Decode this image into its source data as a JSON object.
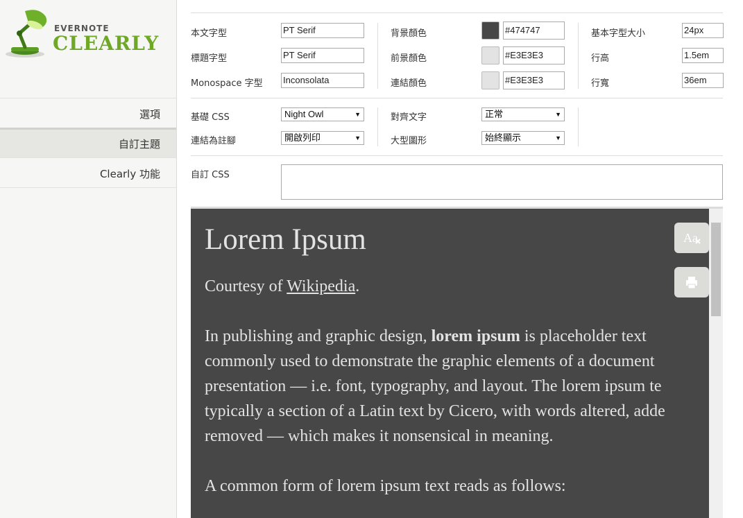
{
  "brand": {
    "small": "EVERNOTE",
    "big": "CLEARLY"
  },
  "nav": [
    {
      "label": "選項",
      "active": false
    },
    {
      "label": "自訂主題",
      "active": true
    },
    {
      "label": "Clearly 功能",
      "active": false
    }
  ],
  "fonts": {
    "body_label": "本文字型",
    "body_value": "PT Serif",
    "header_label": "標題字型",
    "header_value": "PT Serif",
    "mono_label": "Monospace 字型",
    "mono_value": "Inconsolata"
  },
  "colors": {
    "bg_label": "背景顏色",
    "bg_value": "#474747",
    "bg_swatch": "#474747",
    "fg_label": "前景顏色",
    "fg_value": "#E3E3E3",
    "fg_swatch": "#E3E3E3",
    "link_label": "連結顏色",
    "link_value": "#E3E3E3",
    "link_swatch": "#E3E3E3"
  },
  "sizes": {
    "base_label": "基本字型大小",
    "base_value": "24px",
    "line_height_label": "行高",
    "line_height_value": "1.5em",
    "line_width_label": "行寬",
    "line_width_value": "36em"
  },
  "options": {
    "base_css_label": "基礎 CSS",
    "base_css_value": "Night Owl",
    "footnote_label": "連結為註腳",
    "footnote_value": "開啟列印",
    "align_label": "對齊文字",
    "align_value": "正常",
    "images_label": "大型圖形",
    "images_value": "始終顯示"
  },
  "custom_css": {
    "label": "自訂 CSS",
    "value": ""
  },
  "preview": {
    "title": "Lorem Ipsum",
    "courtesy_prefix": "Courtesy of ",
    "courtesy_link": "Wikipedia",
    "courtesy_suffix": ".",
    "p1_pre": "In publishing and graphic design, ",
    "p1_bold": "lorem ipsum",
    "p1_post": " is placeholder text",
    "p1_l2": "commonly used to demonstrate the graphic elements of a document",
    "p1_l3": "presentation — i.e. font, typography, and layout. The lorem ipsum te",
    "p1_l4": "typically a section of a Latin text by Cicero, with words altered, adde",
    "p1_l5": "removed — which makes it nonsensical in meaning.",
    "p2": "A common form of lorem ipsum text reads as follows:",
    "text_size_icon": "Aa",
    "print_icon": "printer-icon"
  }
}
